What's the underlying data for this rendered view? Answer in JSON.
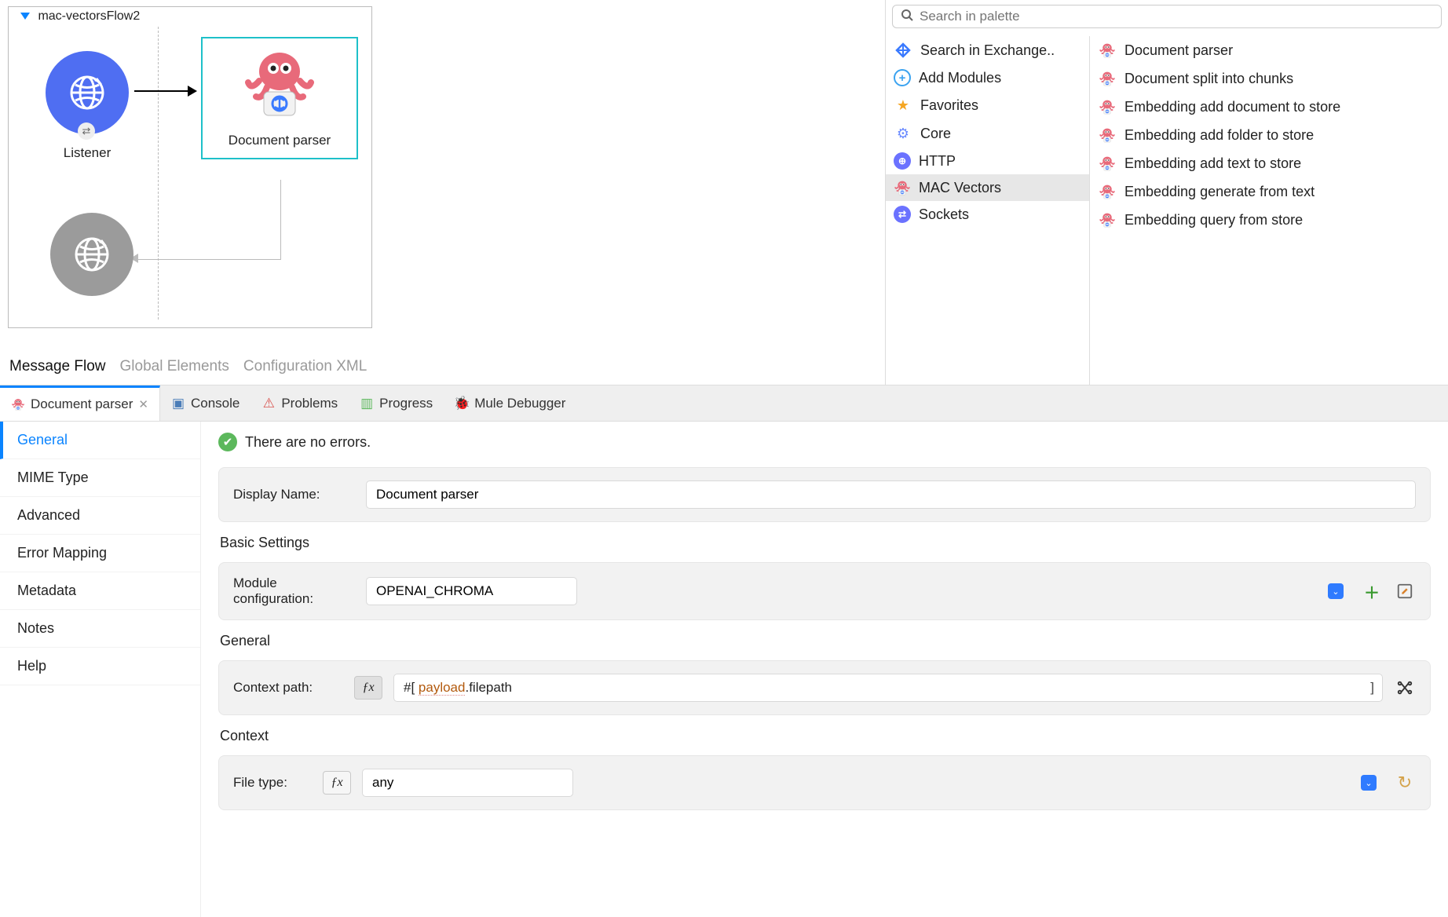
{
  "flow": {
    "name": "mac-vectorsFlow2",
    "nodes": {
      "listener": "Listener",
      "docparser": "Document parser"
    },
    "tabs": {
      "messageFlow": "Message Flow",
      "globalElements": "Global Elements",
      "configXml": "Configuration XML"
    }
  },
  "palette": {
    "searchPlaceholder": "Search in palette",
    "left": {
      "exchange": "Search in Exchange..",
      "addModules": "Add Modules",
      "favorites": "Favorites",
      "core": "Core",
      "http": "HTTP",
      "macVectors": "MAC Vectors",
      "sockets": "Sockets"
    },
    "right": {
      "docParser": "Document parser",
      "docSplit": "Document split into chunks",
      "embAddDoc": "Embedding add document to store",
      "embAddFolder": "Embedding add folder to store",
      "embAddText": "Embedding add text to store",
      "embGen": "Embedding generate from text",
      "embQuery": "Embedding query from store"
    }
  },
  "bottomTabs": {
    "docParser": "Document parser",
    "console": "Console",
    "problems": "Problems",
    "progress": "Progress",
    "muleDebugger": "Mule Debugger"
  },
  "sideNav": {
    "general": "General",
    "mime": "MIME Type",
    "advanced": "Advanced",
    "errMap": "Error Mapping",
    "metadata": "Metadata",
    "notes": "Notes",
    "help": "Help"
  },
  "detail": {
    "noErrors": "There are no errors.",
    "displayNameLabel": "Display Name:",
    "displayNameValue": "Document parser",
    "basicSettings": "Basic Settings",
    "moduleConfigLabel": "Module configuration:",
    "moduleConfigValue": "OPENAI_CHROMA",
    "generalHead": "General",
    "contextPathLabel": "Context path:",
    "exprPrefix": "#[ ",
    "exprPayload": "payload",
    "exprFilepath": ".filepath",
    "exprSuffix": "]",
    "contextHead": "Context",
    "fileTypeLabel": "File type:",
    "fileTypeValue": "any"
  }
}
